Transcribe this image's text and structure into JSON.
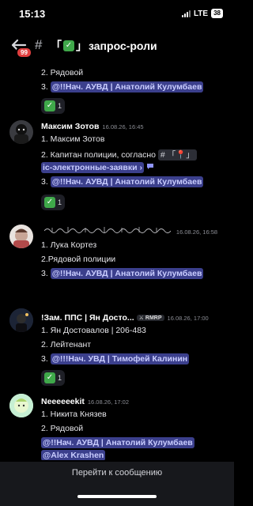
{
  "status": {
    "time": "15:13",
    "network": "LTE",
    "battery": "38"
  },
  "header": {
    "unread_badge": "99",
    "hash": "#",
    "bracket_open": "「",
    "check_mark": "✓",
    "bracket_close": "」",
    "channel_name": "запрос-роли"
  },
  "messages": [
    {
      "partial": true,
      "lines": [
        "2.  Рядовой"
      ],
      "mention_line": {
        "prefix": "3.  ",
        "mention": "@!!Нач. АУВД | Анатолий Кулумбаев"
      },
      "reaction_count": "1"
    },
    {
      "author": "Максим Зотов",
      "timestamp": "16.08.26, 16:45",
      "line1": "1.  Максим Зотов",
      "line2": "2.  Капитан полиции, согласно",
      "channel_ref": "# 「📍」",
      "channel_ref_cont": "ic-электронные-заявки ›",
      "mention_line": {
        "prefix": "3.  ",
        "mention": "@!!Нач. АУВД | Анатолий Кулумбаев"
      },
      "reaction_count": "1"
    },
    {
      "author": "(decorative Arabic-script nickname)",
      "timestamp": "16.08.26, 16:58",
      "line1": "1. Лука Кортез",
      "line2": "2.Рядовой полиции",
      "mention_line": {
        "prefix": "3.  ",
        "mention": "@!!Нач. АУВД | Анатолий Кулумбаев"
      }
    },
    {
      "author": "!Зам. ППС | Ян Досто...",
      "tag": "RMRP",
      "timestamp": "16.08.26, 17:00",
      "line1": "1.  Ян Достовалов | 206-483",
      "line2": "2.  Лейтенант",
      "mention_line": {
        "prefix": "3.  ",
        "mention": "@!!!Нач. УВД | Тимофей Калинин"
      },
      "reaction_count": "1"
    },
    {
      "author": "Neeeeeekit",
      "timestamp": "16.08.26, 17:02",
      "line1": "1.  Никита Князев",
      "line2": "2.  Рядовой",
      "mention1": "@!!Нач. АУВД | Анатолий Кулумбаев",
      "mention2": "@Alex Krashen"
    }
  ],
  "jump_label": "Перейти к сообщению",
  "colors": {
    "background": "#000000",
    "mention_bg": "#3b3f8c",
    "mention_text": "#c9cdff",
    "check_green": "#3fa84a",
    "badge_red": "#e03e3e"
  }
}
